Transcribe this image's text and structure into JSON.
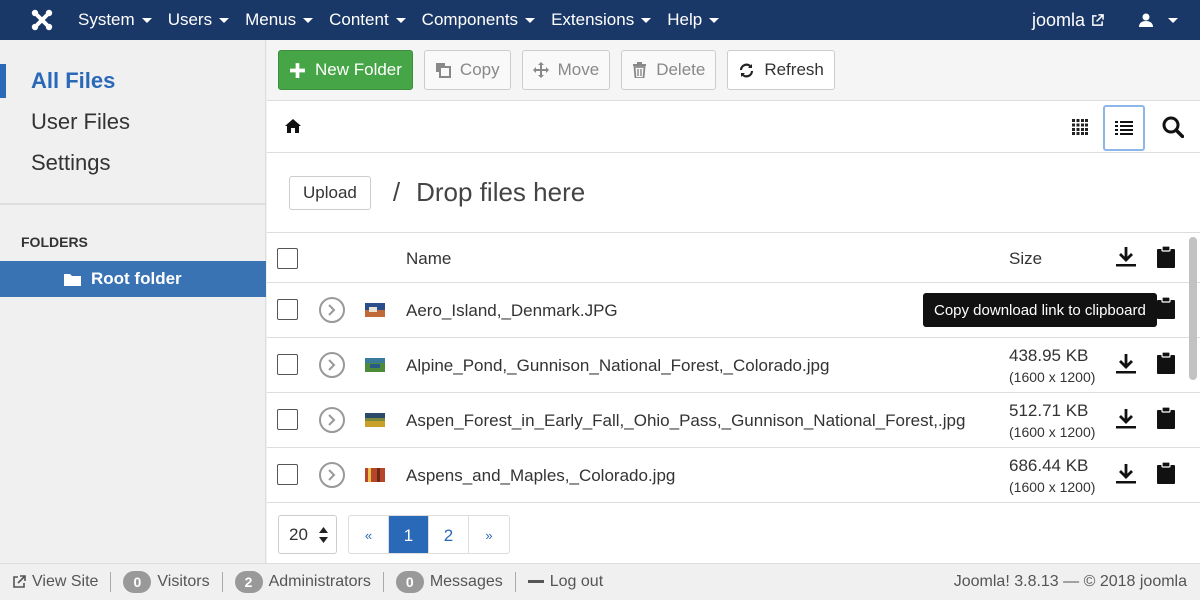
{
  "topnav": {
    "menu": [
      "System",
      "Users",
      "Menus",
      "Content",
      "Components",
      "Extensions",
      "Help"
    ],
    "site": "joomla"
  },
  "sidebar": {
    "items": [
      {
        "label": "All Files"
      },
      {
        "label": "User Files"
      },
      {
        "label": "Settings"
      }
    ],
    "folders_title": "FOLDERS",
    "root_folder": "Root folder"
  },
  "toolbar": {
    "new_folder": "New Folder",
    "copy": "Copy",
    "move": "Move",
    "delete": "Delete",
    "refresh": "Refresh"
  },
  "upload": {
    "button": "Upload",
    "separator": "/",
    "drop_text": "Drop files here"
  },
  "table": {
    "name_header": "Name",
    "size_header": "Size",
    "rows": [
      {
        "name": "Aero_Island,_Denmark.JPG",
        "size": "",
        "dims": ""
      },
      {
        "name": "Alpine_Pond,_Gunnison_National_Forest,_Colorado.jpg",
        "size": "438.95 KB",
        "dims": "(1600 x 1200)"
      },
      {
        "name": "Aspen_Forest_in_Early_Fall,_Ohio_Pass,_Gunnison_National_Forest,.jpg",
        "size": "512.71 KB",
        "dims": "(1600 x 1200)"
      },
      {
        "name": "Aspens_and_Maples,_Colorado.jpg",
        "size": "686.44 KB",
        "dims": "(1600 x 1200)"
      }
    ]
  },
  "tooltip": "Copy download link to clipboard",
  "pagination": {
    "limit": "20",
    "prev": "«",
    "pages": [
      "1",
      "2"
    ],
    "next": "»"
  },
  "statusbar": {
    "view_site": "View Site",
    "visitors_count": "0",
    "visitors": "Visitors",
    "admins_count": "2",
    "admins": "Administrators",
    "messages_count": "0",
    "messages": "Messages",
    "logout": "Log out",
    "version": "Joomla! 3.8.13  —  © 2018 joomla"
  },
  "colors": {
    "topnav_bg": "#1a3867",
    "accent": "#2a69b8",
    "new_button": "#46a546"
  }
}
